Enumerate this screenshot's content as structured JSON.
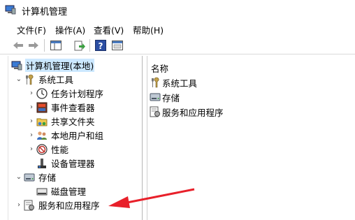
{
  "window": {
    "title": "计算机管理"
  },
  "menu": [
    "文件(F)",
    "操作(A)",
    "查看(V)",
    "帮助(H)"
  ],
  "toolbar": {
    "buttons": [
      "back-icon",
      "forward-icon",
      "show-hide-tree-icon",
      "export-icon",
      "help-icon",
      "properties-icon"
    ]
  },
  "tree": {
    "root": "计算机管理(本地)",
    "system_tools": "系统工具",
    "task_scheduler": "任务计划程序",
    "event_viewer": "事件查看器",
    "shared_folders": "共享文件夹",
    "local_users": "本地用户和组",
    "performance": "性能",
    "device_manager": "设备管理器",
    "storage": "存储",
    "disk_management": "磁盘管理",
    "services_apps": "服务和应用程序"
  },
  "list": {
    "header": "名称",
    "items": [
      "系统工具",
      "存储",
      "服务和应用程序"
    ]
  },
  "colors": {
    "selection": "#cce8ff",
    "annotation_arrow": "#e8202a"
  }
}
